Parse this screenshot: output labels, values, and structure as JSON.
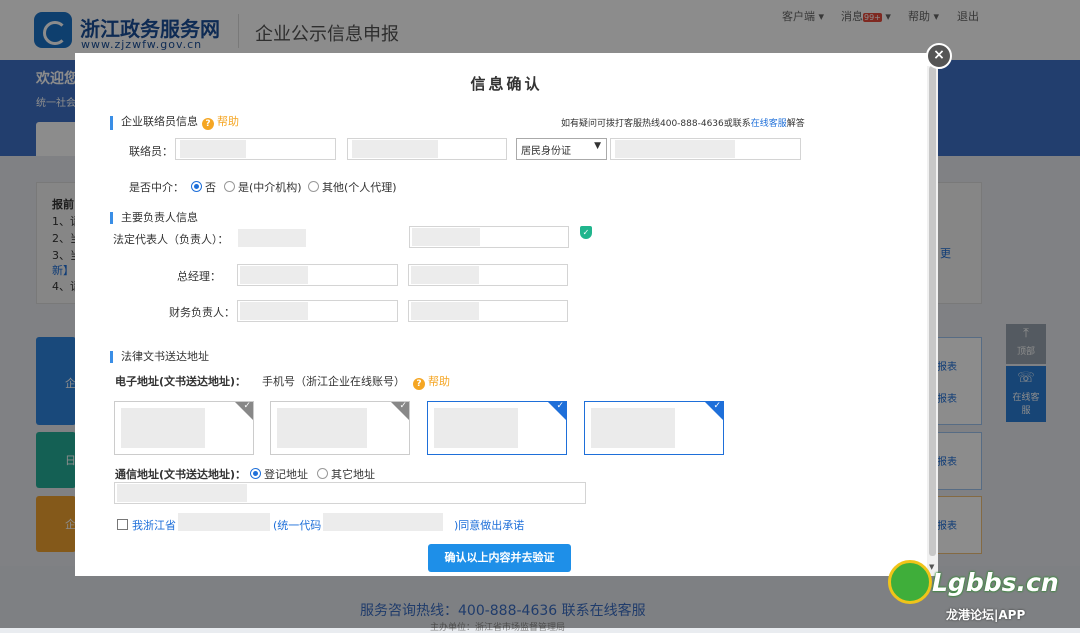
{
  "header": {
    "site_title": "浙江政务服务网",
    "site_url": "www.zjzwfw.gov.cn",
    "system_title": "企业公示信息申报",
    "nav": {
      "client": "客户端 ▾",
      "messages": "消息",
      "messages_badge": "99+",
      "messages_arrow": "▾",
      "help": "帮助 ▾",
      "logout": "退出"
    }
  },
  "background": {
    "welcome": "欢迎您",
    "credit_prefix": "统一社会",
    "notice_title": "报前",
    "notice_lines": [
      "1、请",
      "2、当",
      "3、当",
      "新】",
      "4、请"
    ],
    "notice_right": "更",
    "left_cards": [
      "企",
      "日",
      "企"
    ],
    "right_cards": [
      [
        "报表",
        "报表"
      ],
      [
        "报表"
      ],
      [
        "报表"
      ]
    ],
    "side_buttons": {
      "top": "顶部",
      "online": "在线客服"
    },
    "hotline": "服务咨询热线：400-888-4636    联系在线客服",
    "copyright": "主办单位：浙江省市场监督管理局"
  },
  "modal": {
    "title": "信息确认",
    "close": "×",
    "contact_section": "企业联络员信息",
    "help_label": "帮助",
    "hotline_prefix": "如有疑问可拨打客服热线400-888-4636或联系",
    "hotline_link": "在线客服",
    "hotline_suffix": "解答",
    "contact_label": "联络员：",
    "id_type": "居民身份证",
    "intermediary_label": "是否中介：",
    "intermediary_options": [
      "否",
      "是(中介机构)",
      "其他(个人代理)"
    ],
    "leader_section": "主要负责人信息",
    "legal_rep_label": "法定代表人（负责人）：",
    "gm_label": "总经理：",
    "finance_label": "财务负责人：",
    "legal_section": "法律文书送达地址",
    "e_address_label": "电子地址(文书送达地址)：",
    "e_address_value": "手机号（浙江企业在线账号）",
    "mail_address_label": "通信地址(文书送达地址)：",
    "mail_options": [
      "登记地址",
      "其它地址"
    ],
    "promise_prefix": "我浙江省",
    "promise_mid": "(统一代码",
    "promise_suffix": ")同意做出承诺",
    "confirm_button": "确认以上内容并去验证"
  },
  "watermark": {
    "brand": "Lgbbs.cn",
    "sub": "龙港论坛|APP"
  },
  "colors": {
    "accent": "#1e8fe8",
    "banner": "#3f72c8",
    "help": "#f5a623",
    "verified": "#21b58d"
  }
}
